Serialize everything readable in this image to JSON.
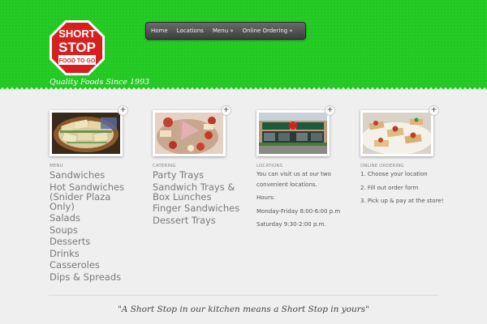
{
  "logo": {
    "line1": "SHORT",
    "line2": "STOP",
    "line3": "FOOD TO GO",
    "colors": {
      "octagon": "#d81f1f",
      "border": "#ffffff"
    }
  },
  "tagline": "Quality Foods Since 1993",
  "nav": {
    "items": [
      "Home",
      "Locations",
      "Menu »",
      "Online Ordering »"
    ]
  },
  "columns": {
    "menu": {
      "heading": "MENU",
      "image": "sandwich-platter",
      "items": [
        "Sandwiches",
        "Hot Sandwiches (Snider Plaza Only)",
        "Salads",
        "Soups",
        "Desserts",
        "Drinks",
        "Casseroles",
        "Dips & Spreads"
      ]
    },
    "catering": {
      "heading": "CATERING",
      "image": "party-tray",
      "items": [
        "Party Trays",
        "Sandwich Trays & Box Lunches",
        "Finger Sandwiches",
        "Dessert Trays"
      ]
    },
    "locations": {
      "heading": "LOCATIONS",
      "image": "storefront",
      "text1": "You can visit us at our two convenient locations.",
      "text2": "Hours:",
      "text3": "Monday-Friday 8:00-6:00 p.m",
      "text4": "Saturday 9:30-2:00 p.m."
    },
    "ordering": {
      "heading": "ONLINE ORDERING",
      "image": "appetizers",
      "steps": [
        "1. Choose your location",
        "2. Fill out order form",
        "3. Pick up & pay at the store!"
      ]
    }
  },
  "quote": "\"A Short Stop in our kitchen means a Short Stop in yours\"",
  "colors": {
    "header": "#22c922",
    "body": "#efefef",
    "nav": "#4a4a4a"
  }
}
